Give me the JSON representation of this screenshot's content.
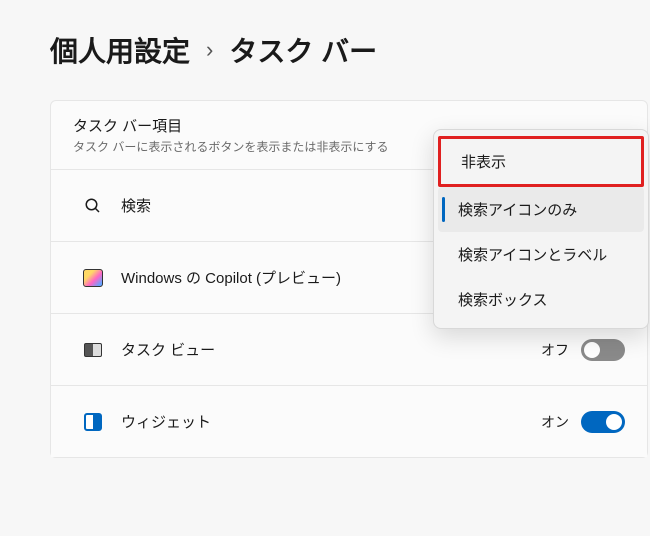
{
  "breadcrumb": {
    "parent": "個人用設定",
    "current": "タスク バー"
  },
  "section": {
    "title": "タスク バー項目",
    "description": "タスク バーに表示されるボタンを表示または非表示にする"
  },
  "rows": {
    "search": {
      "label": "検索"
    },
    "copilot": {
      "label": "Windows の Copilot (プレビュー)"
    },
    "taskview": {
      "label": "タスク ビュー",
      "value": "オフ"
    },
    "widgets": {
      "label": "ウィジェット",
      "value": "オン"
    }
  },
  "dropdown": {
    "option_hidden": "非表示",
    "option_icon_only": "検索アイコンのみ",
    "option_icon_and_label": "検索アイコンとラベル",
    "option_search_box": "検索ボックス",
    "selected_key": "option_icon_only"
  }
}
